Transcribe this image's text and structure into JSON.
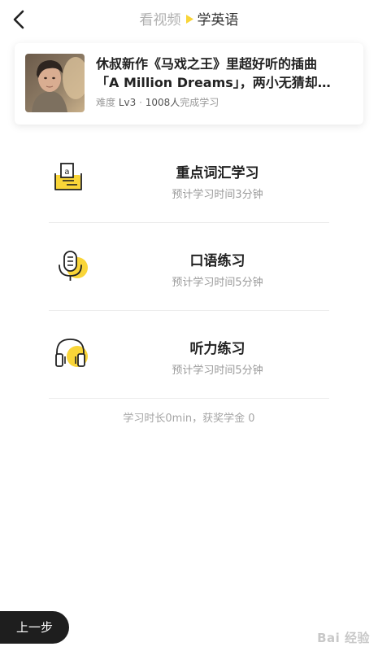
{
  "header": {
    "crumb_inactive": "看视频",
    "crumb_active": "学英语"
  },
  "video": {
    "title_line1": "休叔新作《马戏之王》里超好听的插曲",
    "title_line2": "「A Million Dreams」，两小无猜却…",
    "difficulty_label": "难度",
    "difficulty_value": "Lv3",
    "separator": "·",
    "learners": "1008人",
    "learners_suffix": "完成学习"
  },
  "items": [
    {
      "title": "重点词汇学习",
      "subtitle": "预计学习时间3分钟",
      "icon": "vocabulary-card-icon"
    },
    {
      "title": "口语练习",
      "subtitle": "预计学习时间5分钟",
      "icon": "microphone-icon"
    },
    {
      "title": "听力练习",
      "subtitle": "预计学习时间5分钟",
      "icon": "headphones-icon"
    }
  ],
  "summary": "学习时长0min，获奖学金 0",
  "footer": {
    "prev_label": "上一步",
    "watermark": "Bai 经验"
  },
  "colors": {
    "accent_yellow": "#F9D538",
    "prev_button_bg": "#1E1E1E"
  }
}
